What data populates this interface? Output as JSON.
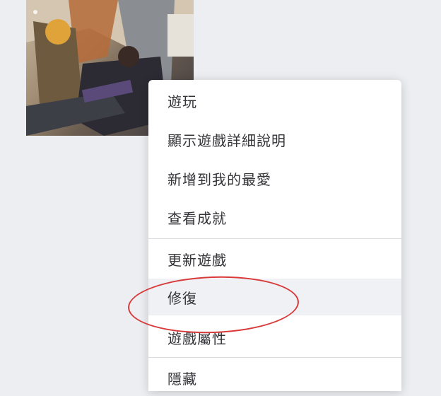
{
  "game": {
    "icon": "game-cover-art"
  },
  "context_menu": {
    "items": [
      {
        "label": "遊玩"
      },
      {
        "label": "顯示遊戲詳細說明"
      },
      {
        "label": "新增到我的最愛"
      },
      {
        "label": "查看成就"
      },
      {
        "label": "更新遊戲"
      },
      {
        "label": "修復"
      },
      {
        "label": "遊戲屬性"
      },
      {
        "label": "隱藏"
      }
    ]
  },
  "annotation": {
    "color": "#d83a3a"
  }
}
